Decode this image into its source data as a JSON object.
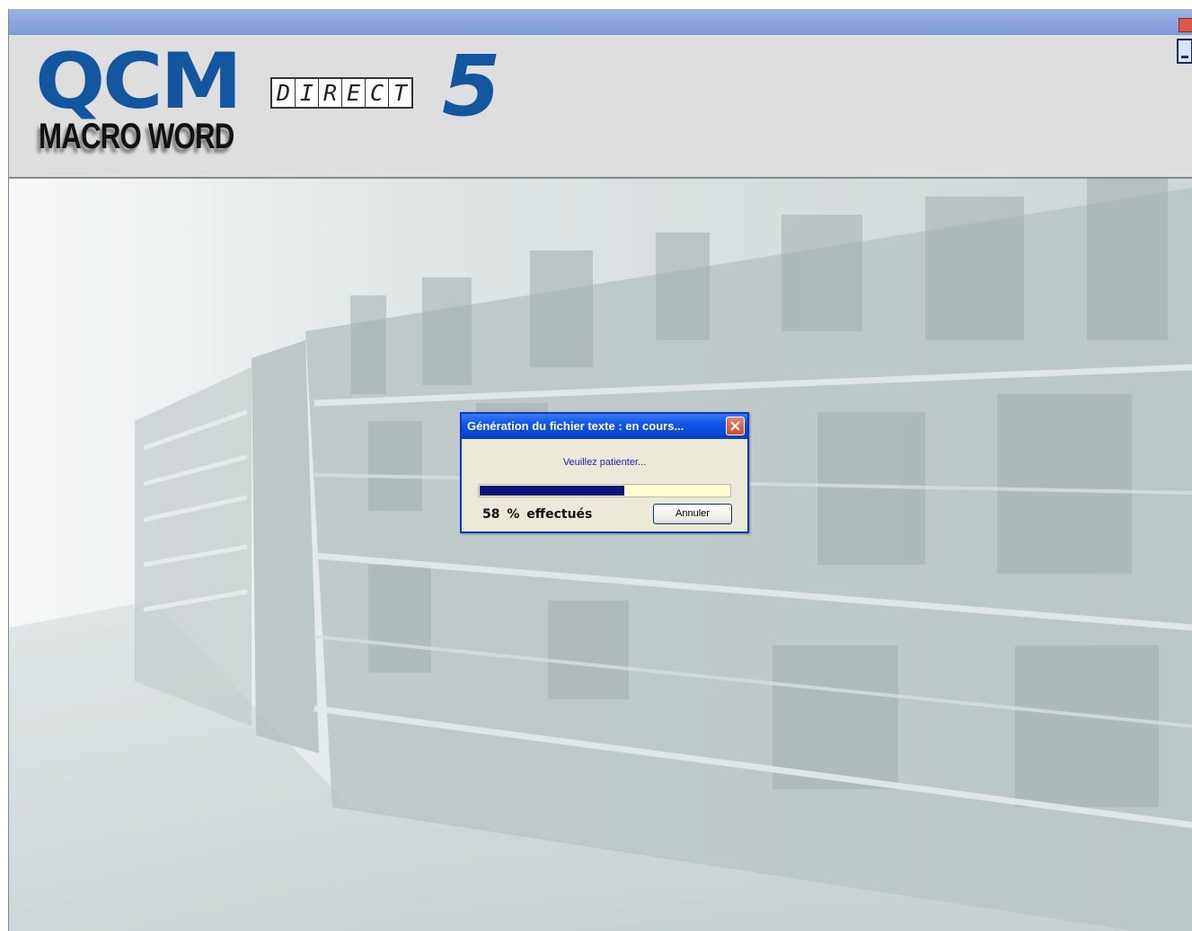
{
  "app": {
    "logo_qcm": "QCM",
    "logo_macro": "MACRO WORD",
    "logo_direct_letters": [
      "D",
      "I",
      "R",
      "E",
      "C",
      "T"
    ],
    "logo_version": "5",
    "brand_color": "#1356a0"
  },
  "window_controls": {
    "close_icon": "close-icon",
    "minimize_icon": "minimize-icon"
  },
  "dialog": {
    "title": "Génération du fichier texte : en cours...",
    "message": "Veuillez patienter...",
    "progress_fraction": 0.58,
    "progress_text": "58 % effectués",
    "cancel_label": "Annuler",
    "titlebar_color": "#0a55e0",
    "progress_color": "#07167a",
    "track_color": "#fffdd0"
  }
}
